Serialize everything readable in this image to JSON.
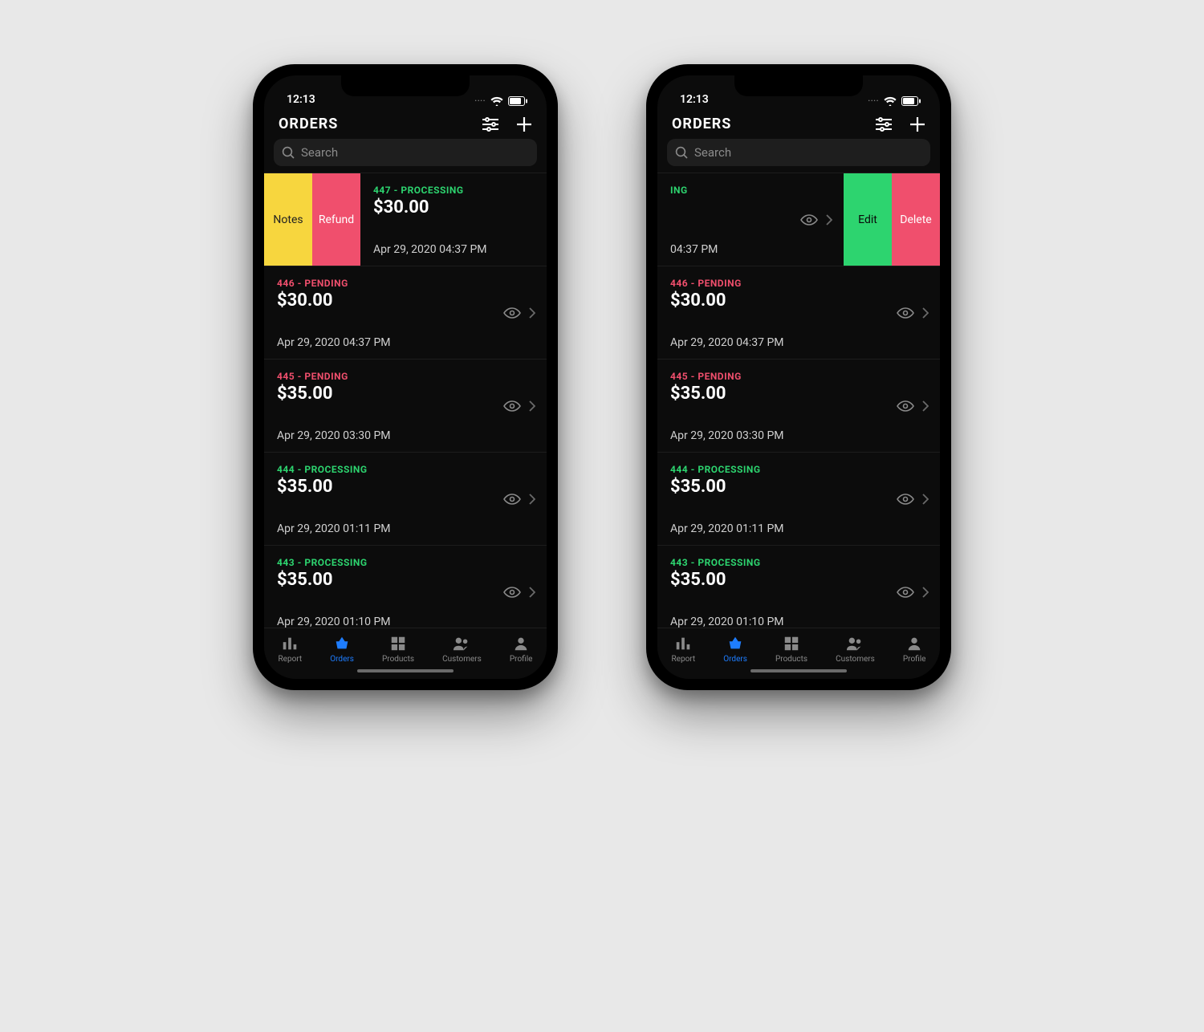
{
  "statusbar": {
    "time": "12:13"
  },
  "header": {
    "title": "ORDERS"
  },
  "search": {
    "placeholder": "Search"
  },
  "swipe_actions": {
    "left": {
      "notes": "Notes",
      "refund": "Refund"
    },
    "right": {
      "edit": "Edit",
      "delete": "Delete"
    }
  },
  "first_row_partial": {
    "status_fragment": "ING",
    "time_fragment": "04:37 PM"
  },
  "orders": [
    {
      "status_line": "447 - PROCESSING",
      "status_class": "processing",
      "amount": "$30.00",
      "date": "Apr 29, 2020 04:37 PM"
    },
    {
      "status_line": "446 - PENDING",
      "status_class": "pending",
      "amount": "$30.00",
      "date": "Apr 29, 2020 04:37 PM"
    },
    {
      "status_line": "445 - PENDING",
      "status_class": "pending",
      "amount": "$35.00",
      "date": "Apr 29, 2020 03:30 PM"
    },
    {
      "status_line": "444 - PROCESSING",
      "status_class": "processing",
      "amount": "$35.00",
      "date": "Apr 29, 2020 01:11 PM"
    },
    {
      "status_line": "443 - PROCESSING",
      "status_class": "processing",
      "amount": "$35.00",
      "date": "Apr 29, 2020 01:10 PM"
    }
  ],
  "tabs": {
    "report": "Report",
    "orders": "Orders",
    "products": "Products",
    "customers": "Customers",
    "profile": "Profile"
  }
}
